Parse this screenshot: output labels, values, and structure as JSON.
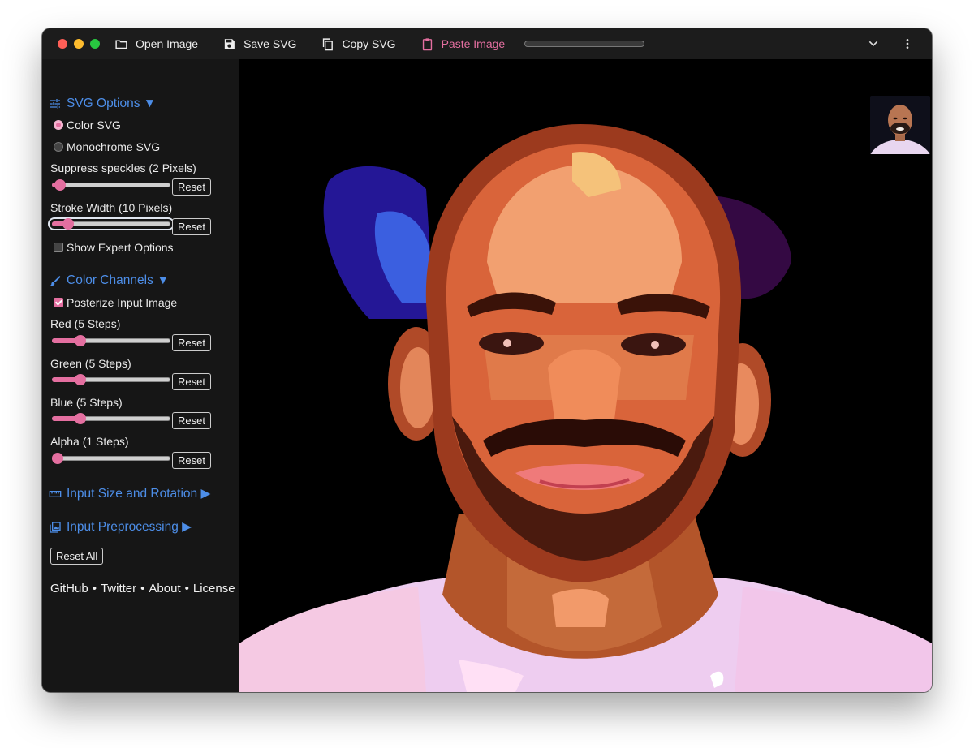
{
  "toolbar": {
    "open_label": "Open Image",
    "save_label": "Save SVG",
    "copy_label": "Copy SVG",
    "paste_label": "Paste Image",
    "progress": 0
  },
  "svg_options": {
    "title": "SVG Options ▼",
    "color_label": "Color SVG",
    "mono_label": "Monochrome SVG",
    "selected_mode": "Color SVG",
    "speckles_label": "Suppress speckles (2 Pixels)",
    "speckles_value": 2,
    "stroke_label": "Stroke Width (10 Pixels)",
    "stroke_value": 10,
    "expert_label": "Show Expert Options",
    "expert_checked": false
  },
  "color_channels": {
    "title": "Color Channels ▼",
    "posterize_label": "Posterize Input Image",
    "posterize_checked": true,
    "red_label": "Red (5 Steps)",
    "green_label": "Green (5 Steps)",
    "blue_label": "Blue (5 Steps)",
    "alpha_label": "Alpha (1 Steps)",
    "red_value": 5,
    "green_value": 5,
    "blue_value": 5,
    "alpha_value": 1
  },
  "sections": {
    "size_rotation": "Input Size and Rotation ▶",
    "preprocessing": "Input Preprocessing ▶"
  },
  "reset_label": "Reset",
  "reset_all_label": "Reset All",
  "footer": {
    "github": "GitHub",
    "twitter": "Twitter",
    "about": "About",
    "license": "License",
    "sep": "•"
  },
  "colors": {
    "accent": "#e46fa0",
    "link": "#4d8ee8"
  }
}
